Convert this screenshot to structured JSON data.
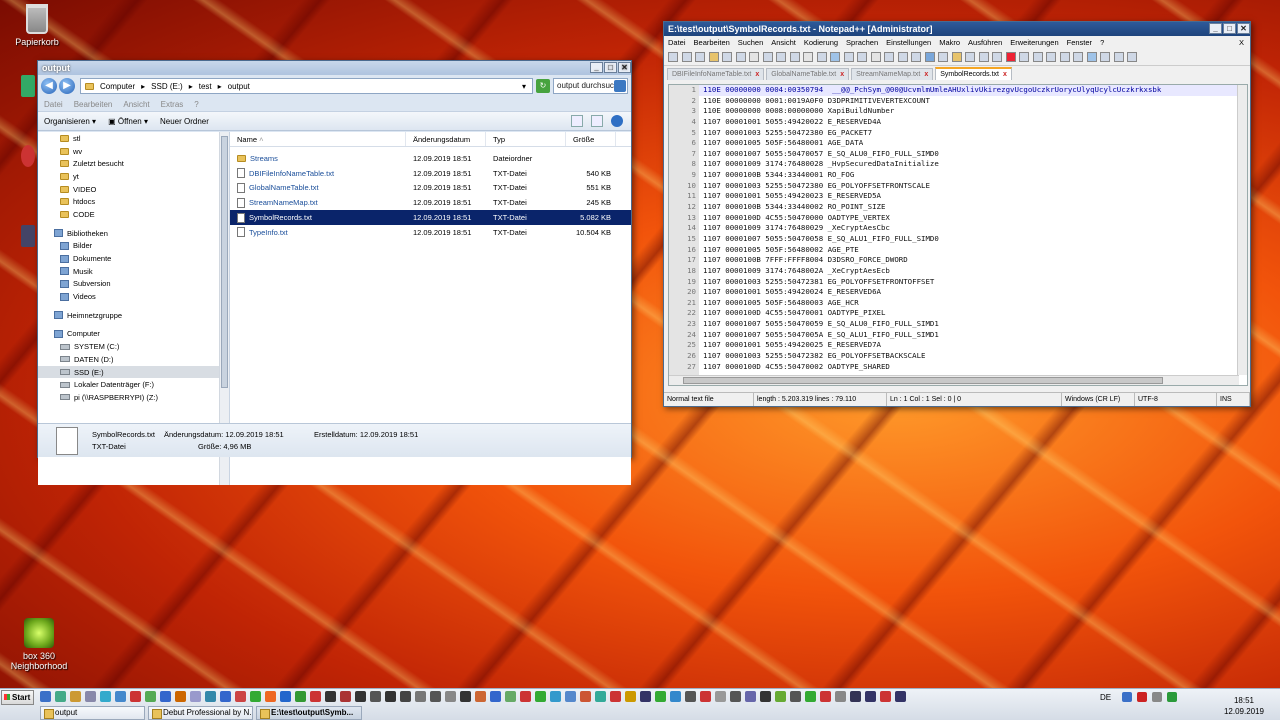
{
  "desktop": {
    "icons": [
      {
        "label": "Papierkorb"
      },
      {
        "label": "box 360 Neighborhood"
      }
    ]
  },
  "explorer": {
    "title": "output",
    "address": [
      "Computer",
      "SSD (E:)",
      "test",
      "output"
    ],
    "search_placeholder": "output durchsuc...",
    "menu": [
      "Datei",
      "Bearbeiten",
      "Ansicht",
      "Extras",
      "?"
    ],
    "toolbar": {
      "organize": "Organisieren",
      "open": "Öffnen",
      "new_folder": "Neuer Ordner"
    },
    "nav_items": [
      {
        "label": "stl",
        "kind": "folder"
      },
      {
        "label": "wv",
        "kind": "folder"
      },
      {
        "label": "Zuletzt besucht",
        "kind": "folder"
      },
      {
        "label": "yt",
        "kind": "folder"
      },
      {
        "label": "VIDEO",
        "kind": "folder"
      },
      {
        "label": "htdocs",
        "kind": "folder"
      },
      {
        "label": "CODE",
        "kind": "folder"
      }
    ],
    "libraries_label": "Bibliotheken",
    "libraries": [
      "Bilder",
      "Dokumente",
      "Musik",
      "Subversion",
      "Videos"
    ],
    "homegroup_label": "Heimnetzgruppe",
    "computer_label": "Computer",
    "drives": [
      "SYSTEM (C:)",
      "DATEN (D:)",
      "SSD (E:)",
      "Lokaler Datenträger (F:)",
      "pi (\\\\RASPBERRYPI) (Z:)"
    ],
    "columns": {
      "name": "Name",
      "date": "Änderungsdatum",
      "type": "Typ",
      "size": "Größe"
    },
    "files": [
      {
        "name": "Streams",
        "date": "12.09.2019 18:51",
        "type": "Dateiordner",
        "size": ""
      },
      {
        "name": "DBIFileInfoNameTable.txt",
        "date": "12.09.2019 18:51",
        "type": "TXT-Datei",
        "size": "540 KB"
      },
      {
        "name": "GlobalNameTable.txt",
        "date": "12.09.2019 18:51",
        "type": "TXT-Datei",
        "size": "551 KB"
      },
      {
        "name": "StreamNameMap.txt",
        "date": "12.09.2019 18:51",
        "type": "TXT-Datei",
        "size": "245 KB"
      },
      {
        "name": "SymbolRecords.txt",
        "date": "12.09.2019 18:51",
        "type": "TXT-Datei",
        "size": "5.082 KB"
      },
      {
        "name": "TypeInfo.txt",
        "date": "12.09.2019 18:51",
        "type": "TXT-Datei",
        "size": "10.504 KB"
      }
    ],
    "details": {
      "filename": "SymbolRecords.txt",
      "type": "TXT-Datei",
      "modified": "Änderungsdatum: 12.09.2019 18:51",
      "created": "Erstelldatum: 12.09.2019 18:51",
      "size": "Größe: 4,96 MB"
    }
  },
  "notepad": {
    "title": "E:\\test\\output\\SymbolRecords.txt - Notepad++ [Administrator]",
    "menu": [
      "Datei",
      "Bearbeiten",
      "Suchen",
      "Ansicht",
      "Kodierung",
      "Sprachen",
      "Einstellungen",
      "Makro",
      "Ausführen",
      "Erweiterungen",
      "Fenster",
      "?"
    ],
    "menu_close": "X",
    "tabs": [
      "DBIFileInfoNameTable.txt",
      "GlobalNameTable.txt",
      "StreamNameMap.txt",
      "SymbolRecords.txt"
    ],
    "lines": [
      "110E 00000000 0004:00350794  __@@_PchSym_@00@UcvmlmUmleAHUxlivUkirezgvUcgoUczkrUorycUlyqUcylcUczkrkxsbk",
      "110E 00000000 0001:0019A0F0 D3DPRIMITIVEVERTEXCOUNT",
      "110E 00000000 0008:00000000 XapiBuildNumber",
      "1107 00001001 5055:49420022 E_RESERVED4A",
      "1107 00001003 5255:50472380 EG_PACKET7",
      "1107 00001005 505F:56480001 AGE_DATA",
      "1107 00001007 5055:50470057 E_SQ_ALU0_FIFO_FULL_SIMD0",
      "1107 00001009 3174:76480028 _HvpSecuredDataInitialize",
      "1107 0000100B 5344:33440001 RO_FOG",
      "1107 00001003 5255:50472380 EG_POLYOFFSETFRONTSCALE",
      "1107 00001001 5055:49420023 E_RESERVED5A",
      "1107 0000100B 5344:33440002 RO_POINT_SIZE",
      "1107 0000100D 4C55:50470000 OADTYPE_VERTEX",
      "1107 00001009 3174:76480029 _XeCryptAesCbc",
      "1107 00001007 5055:50470058 E_SQ_ALU1_FIFO_FULL_SIMD0",
      "1107 00001005 505F:56480002 AGE_PTE",
      "1107 0000100B 7FFF:FFFF8004 D3DSRO_FORCE_DWORD",
      "1107 00001009 3174:7648002A _XeCryptAesEcb",
      "1107 00001003 5255:50472381 EG_POLYOFFSETFRONTOFFSET",
      "1107 00001001 5055:49420024 E_RESERVED6A",
      "1107 00001005 505F:56480003 AGE_HCR",
      "1107 0000100D 4C55:50470001 OADTYPE_PIXEL",
      "1107 00001007 5055:50470059 E_SQ_ALU0_FIFO_FULL_SIMD1",
      "1107 00001007 5055:5047005A E_SQ_ALU1_FIFO_FULL_SIMD1",
      "1107 00001001 5055:49420025 E_RESERVED7A",
      "1107 00001003 5255:50472382 EG_POLYOFFSETBACKSCALE",
      "1107 0000100D 4C55:50470002 OADTYPE_SHARED"
    ],
    "status": {
      "type": "Normal text file",
      "length": "length : 5.203.319   lines : 79.110",
      "pos": "Ln : 1   Col : 1   Sel : 0 | 0",
      "eol": "Windows (CR LF)",
      "enc": "UTF-8",
      "ins": "INS"
    }
  },
  "taskbar": {
    "start": "Start",
    "windows": [
      "output",
      "Debut Professional by N...",
      "E:\\test\\output\\Symb..."
    ],
    "lang": "DE",
    "time": "18:51",
    "date": "12.09.2019"
  }
}
